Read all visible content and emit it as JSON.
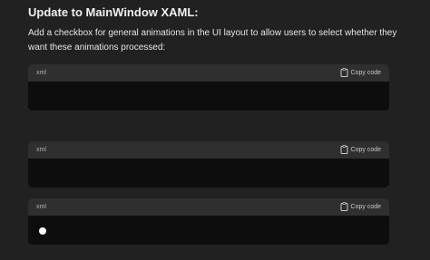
{
  "message": {
    "heading": "Update to MainWindow XAML:",
    "paragraph": "Add a checkbox for general animations in the UI layout to allow users to select whether they want these animations processed:"
  },
  "code_blocks": [
    {
      "language": "xml",
      "copy_label": "Copy code",
      "copy_icon": "clipboard-icon"
    },
    {
      "language": "xml",
      "copy_label": "Copy code",
      "copy_icon": "clipboard-icon"
    },
    {
      "language": "xml",
      "copy_label": "Copy code",
      "copy_icon": "clipboard-icon"
    }
  ],
  "colors": {
    "background": "#212121",
    "code_header": "#2f2f2f",
    "code_body": "#0d0d0d"
  }
}
